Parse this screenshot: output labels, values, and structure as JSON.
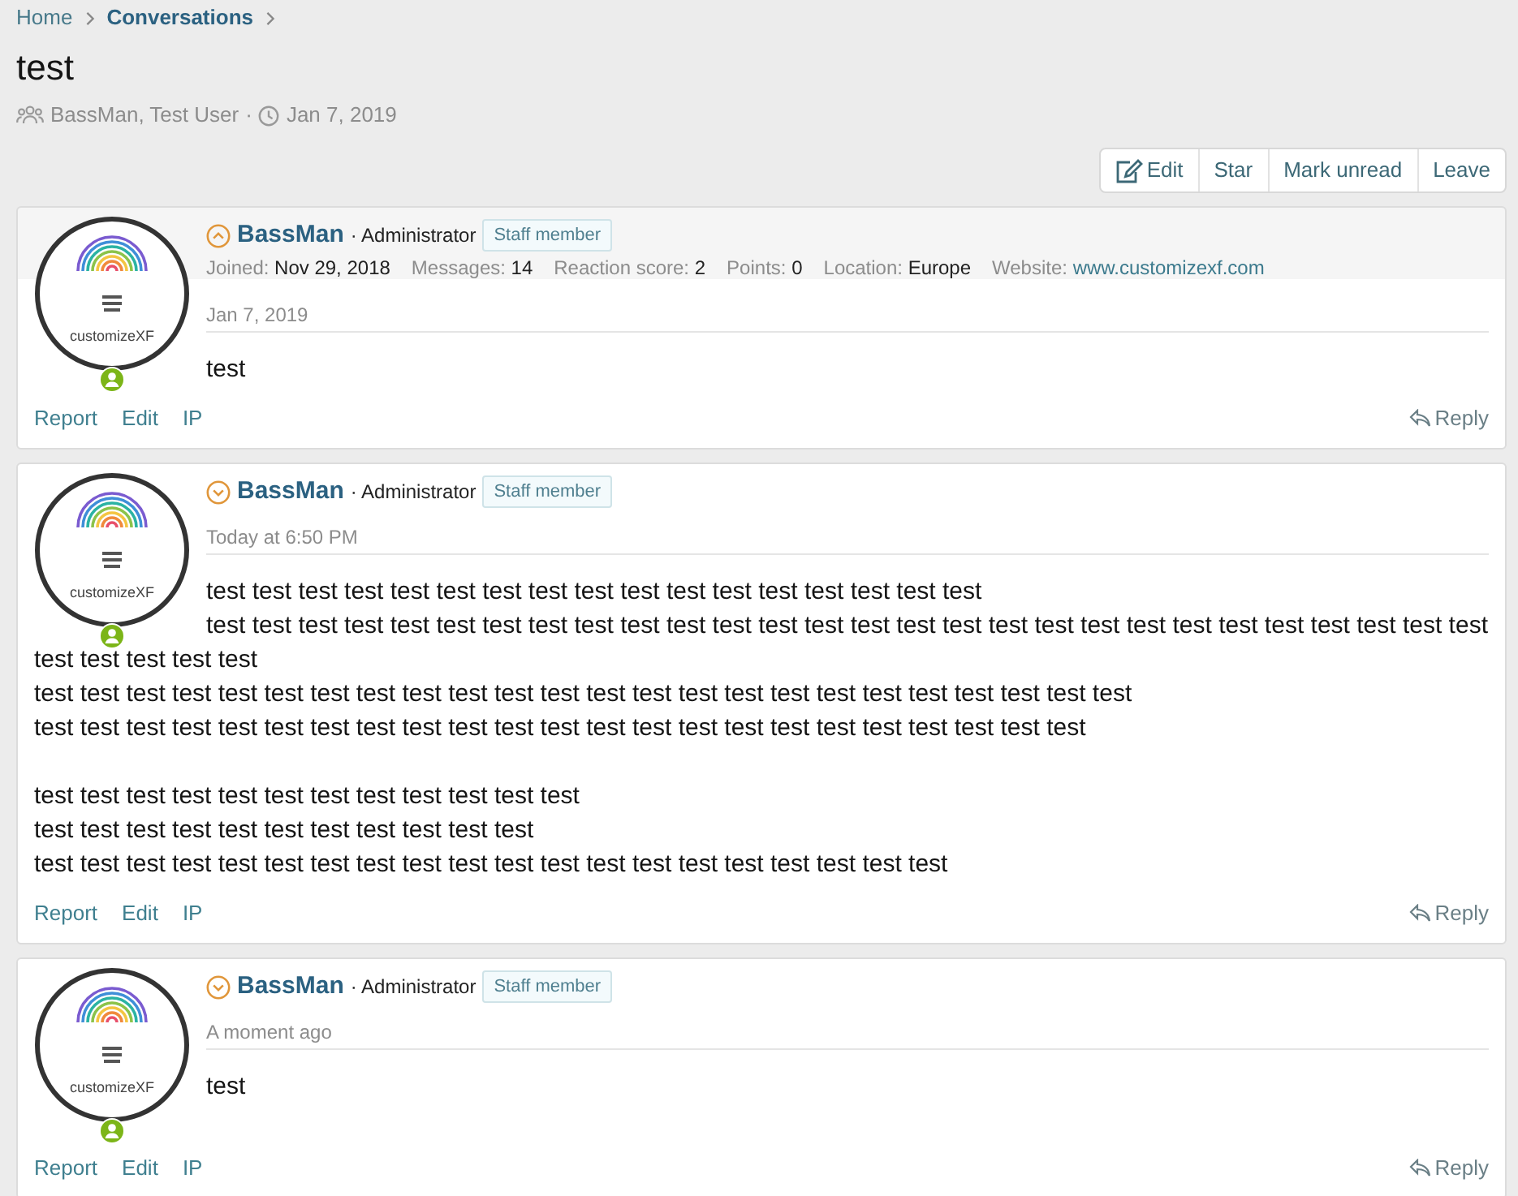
{
  "breadcrumbs": [
    {
      "label": "Home",
      "current": false
    },
    {
      "label": "Conversations",
      "current": true
    }
  ],
  "title": "test",
  "meta": {
    "participants": "BassMan, Test User",
    "separator": "·",
    "date": "Jan 7, 2019"
  },
  "toolbar": [
    {
      "label": "Edit",
      "kind": "icon"
    },
    {
      "label": "Star",
      "kind": "plain"
    },
    {
      "label": "Mark unread",
      "kind": "plain"
    },
    {
      "label": "Leave",
      "kind": "plain"
    }
  ],
  "messages": [
    {
      "avatar_caption": "customizeXF",
      "online": true,
      "expanded": true,
      "user": "BassMan",
      "role": "· Administrator",
      "badge": "Staff member",
      "stats": [
        {
          "label": "Joined:",
          "value": "Nov 29, 2018",
          "kind": "text"
        },
        {
          "label": "Messages:",
          "value": "14",
          "kind": "text"
        },
        {
          "label": "Reaction score:",
          "value": "2",
          "kind": "text"
        },
        {
          "label": "Points:",
          "value": "0",
          "kind": "text"
        },
        {
          "label": "Location:",
          "value": "Europe",
          "kind": "text"
        },
        {
          "label": "Website:",
          "value": "www.customizexf.com",
          "kind": "link"
        }
      ],
      "date": "Jan 7, 2019",
      "paragraphs": [
        [
          "test"
        ]
      ],
      "actions": [
        "Report",
        "Edit",
        "IP"
      ],
      "reply": "Reply"
    },
    {
      "avatar_caption": "customizeXF",
      "online": true,
      "expanded": false,
      "user": "BassMan",
      "role": "· Administrator",
      "badge": "Staff member",
      "date": "Today at 6:50 PM",
      "paragraphs": [
        [
          "test test test test test test test test test test test test test test test test test",
          "test test test test test test test test test test test test test test test test test test test test test test test test test test test test test test test test test",
          "test test test test test test test test test test test test test test test test test test test test test test test test",
          "test test test test test test test test test test test test test test test test test test test test test test test"
        ],
        [
          "test test test test test test test test test test test test",
          "test test test test test test test test test test test",
          "test test test test test test test test test test test test test test test test test test test test"
        ]
      ],
      "actions": [
        "Report",
        "Edit",
        "IP"
      ],
      "reply": "Reply"
    },
    {
      "avatar_caption": "customizeXF",
      "online": true,
      "expanded": false,
      "user": "BassMan",
      "role": "· Administrator",
      "badge": "Staff member",
      "date": "A moment ago",
      "paragraphs": [
        [
          "test"
        ]
      ],
      "actions": [
        "Report",
        "Edit",
        "IP"
      ],
      "reply": "Reply"
    }
  ]
}
